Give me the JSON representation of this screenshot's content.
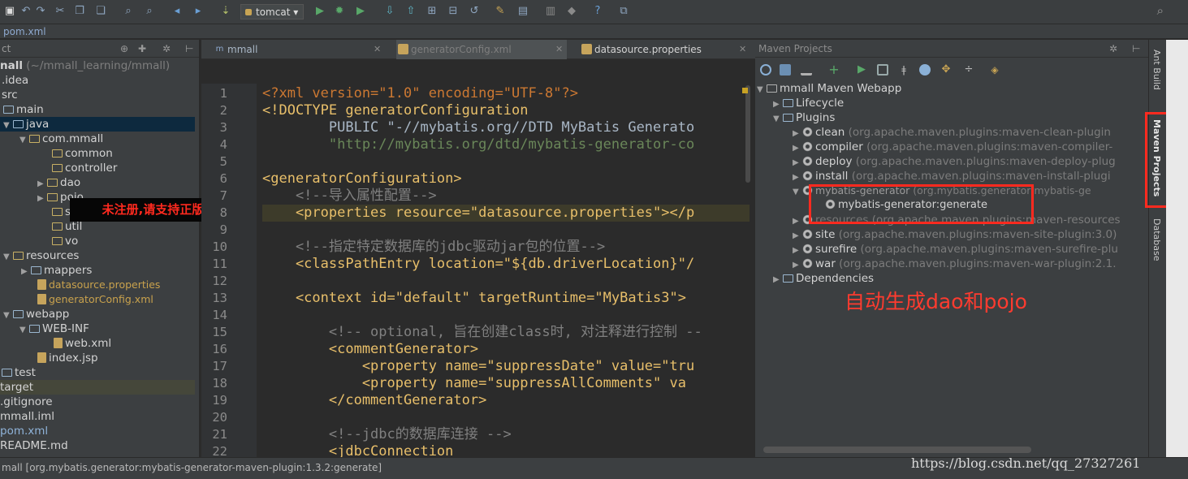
{
  "toolbar": {
    "run_config": "tomcat"
  },
  "breadcrumb": "pom.xml",
  "project": {
    "header_label": "ct",
    "items": [
      {
        "label": "nall",
        "hint": "(~/mmall_learning/mmall)"
      },
      {
        "label": ".idea"
      },
      {
        "label": "src"
      },
      {
        "label": "main"
      },
      {
        "label": "java"
      },
      {
        "label": "com.mmall"
      },
      {
        "label": "common"
      },
      {
        "label": "controller"
      },
      {
        "label": "dao"
      },
      {
        "label": "pojo"
      },
      {
        "label": "s"
      },
      {
        "label": "util"
      },
      {
        "label": "vo"
      },
      {
        "label": "resources"
      },
      {
        "label": "mappers"
      },
      {
        "label": "datasource.properties"
      },
      {
        "label": "generatorConfig.xml"
      },
      {
        "label": "webapp"
      },
      {
        "label": "WEB-INF"
      },
      {
        "label": "web.xml"
      },
      {
        "label": "index.jsp"
      },
      {
        "label": "test"
      },
      {
        "label": "target"
      },
      {
        "label": ".gitignore"
      },
      {
        "label": "mmall.iml"
      },
      {
        "label": "pom.xml"
      },
      {
        "label": "README.md"
      }
    ]
  },
  "badge": "未注册,请支持正版",
  "editor": {
    "tabs": [
      {
        "label": "mmall"
      },
      {
        "label": "generatorConfig.xml"
      },
      {
        "label": "datasource.properties"
      }
    ],
    "lines": [
      {
        "n": "1",
        "t": "<?xml version=\"1.0\" encoding=\"UTF-8\"?>"
      },
      {
        "n": "2",
        "t": "<!DOCTYPE generatorConfiguration"
      },
      {
        "n": "3",
        "t": "        PUBLIC \"-//mybatis.org//DTD MyBatis Generato"
      },
      {
        "n": "4",
        "t": "        \"http://mybatis.org/dtd/mybatis-generator-co"
      },
      {
        "n": "5",
        "t": ""
      },
      {
        "n": "6",
        "t": "<generatorConfiguration>"
      },
      {
        "n": "7",
        "t": "    <!--导入属性配置-->"
      },
      {
        "n": "8",
        "t": "    <properties resource=\"datasource.properties\"></p"
      },
      {
        "n": "9",
        "t": ""
      },
      {
        "n": "10",
        "t": "    <!--指定特定数据库的jdbc驱动jar包的位置-->"
      },
      {
        "n": "11",
        "t": "    <classPathEntry location=\"${db.driverLocation}\"/"
      },
      {
        "n": "12",
        "t": ""
      },
      {
        "n": "13",
        "t": "    <context id=\"default\" targetRuntime=\"MyBatis3\">"
      },
      {
        "n": "14",
        "t": ""
      },
      {
        "n": "15",
        "t": "        <!-- optional, 旨在创建class时, 对注释进行控制 --"
      },
      {
        "n": "16",
        "t": "        <commentGenerator>"
      },
      {
        "n": "17",
        "t": "            <property name=\"suppressDate\" value=\"tru"
      },
      {
        "n": "18",
        "t": "            <property name=\"suppressAllComments\" va"
      },
      {
        "n": "19",
        "t": "        </commentGenerator>"
      },
      {
        "n": "20",
        "t": ""
      },
      {
        "n": "21",
        "t": "        <!--jdbc的数据库连接 -->"
      },
      {
        "n": "22",
        "t": "        <jdbcConnection"
      }
    ]
  },
  "maven": {
    "header": "Maven Projects",
    "root": "mmall Maven Webapp",
    "lifecycle": "Lifecycle",
    "plugins_label": "Plugins",
    "plugins": [
      {
        "name": "clean",
        "coord": "(org.apache.maven.plugins:maven-clean-plugin"
      },
      {
        "name": "compiler",
        "coord": "(org.apache.maven.plugins:maven-compiler-"
      },
      {
        "name": "deploy",
        "coord": "(org.apache.maven.plugins:maven-deploy-plug"
      },
      {
        "name": "install",
        "coord": "(org.apache.maven.plugins:maven-install-plugi"
      },
      {
        "name": "mybatis-generator",
        "coord": "(org.mybatis.generator:mybatis-ge"
      },
      {
        "name": "resources",
        "coord": "(org.apache.maven.plugins:maven-resources"
      },
      {
        "name": "site",
        "coord": "(org.apache.maven.plugins:maven-site-plugin:3.0)"
      },
      {
        "name": "surefire",
        "coord": "(org.apache.maven.plugins:maven-surefire-plu"
      },
      {
        "name": "war",
        "coord": "(org.apache.maven.plugins:maven-war-plugin:2.1."
      }
    ],
    "goal": "mybatis-generator:generate",
    "dependencies": "Dependencies"
  },
  "annotation": "自动生成dao和pojo",
  "rightbar": {
    "ant": "Ant Build",
    "maven": "Maven Projects",
    "database": "Database"
  },
  "status": "mall [org.mybatis.generator:mybatis-generator-maven-plugin:1.3.2:generate]",
  "csdn": "https://blog.csdn.net/qq_27327261",
  "colors": {
    "accent_red": "#ff2a1f",
    "bg": "#2b2b2b",
    "panel": "#3c3f41"
  }
}
